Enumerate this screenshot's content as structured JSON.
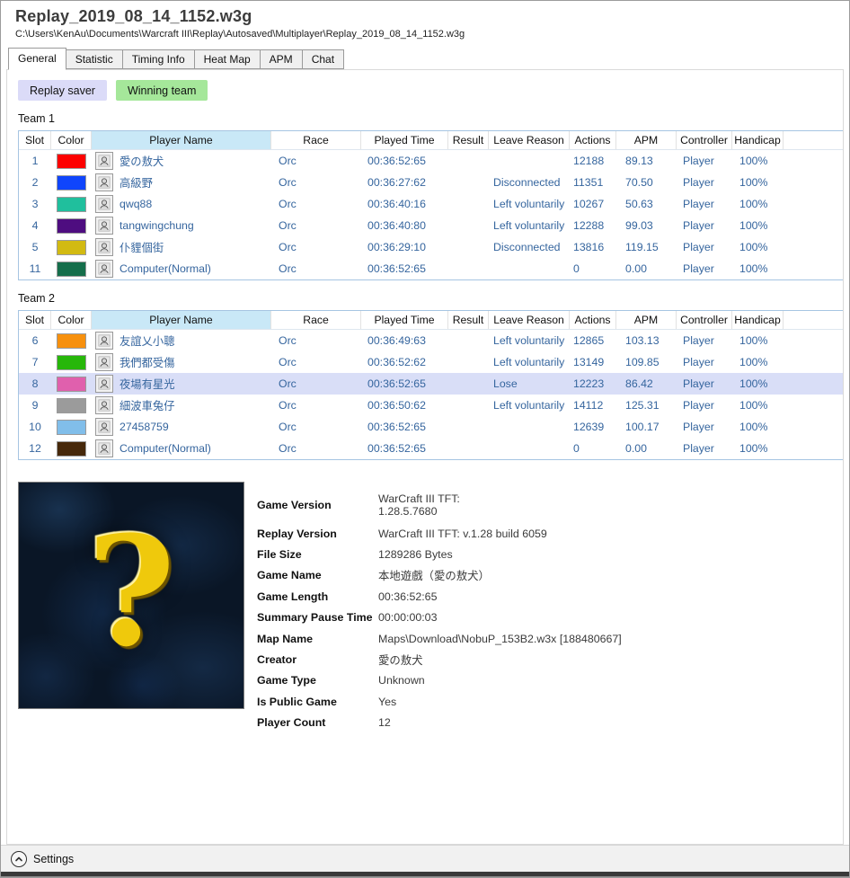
{
  "window": {
    "title": "Replay_2019_08_14_1152.w3g",
    "path": "C:\\Users\\KenAu\\Documents\\Warcraft III\\Replay\\Autosaved\\Multiplayer\\Replay_2019_08_14_1152.w3g"
  },
  "tabs": [
    {
      "label": "General",
      "active": true
    },
    {
      "label": "Statistic",
      "active": false
    },
    {
      "label": "Timing Info",
      "active": false
    },
    {
      "label": "Heat Map",
      "active": false
    },
    {
      "label": "APM",
      "active": false
    },
    {
      "label": "Chat",
      "active": false
    }
  ],
  "toolbar": {
    "replay_saver_label": "Replay saver",
    "winning_team_label": "Winning team"
  },
  "table_columns": [
    "Slot",
    "Color",
    "Player Name",
    "Race",
    "Played Time",
    "Result",
    "Leave Reason",
    "Actions",
    "APM",
    "Controller",
    "Handicap"
  ],
  "teams": [
    {
      "name": "Team 1",
      "rows": [
        {
          "slot": "1",
          "color": "#fd0100",
          "player": "愛の敖犬",
          "race": "Orc",
          "played_time": "00:36:52:65",
          "result": "",
          "leave_reason": "",
          "actions": "12188",
          "apm": "89.13",
          "controller": "Player",
          "handicap": "100%",
          "selected": false
        },
        {
          "slot": "2",
          "color": "#0f45fc",
          "player": "高級野",
          "race": "Orc",
          "played_time": "00:36:27:62",
          "result": "",
          "leave_reason": "Disconnected",
          "actions": "11351",
          "apm": "70.50",
          "controller": "Player",
          "handicap": "100%",
          "selected": false
        },
        {
          "slot": "3",
          "color": "#20bf9d",
          "player": "qwq88",
          "race": "Orc",
          "played_time": "00:36:40:16",
          "result": "",
          "leave_reason": "Left voluntarily",
          "actions": "10267",
          "apm": "50.63",
          "controller": "Player",
          "handicap": "100%",
          "selected": false
        },
        {
          "slot": "4",
          "color": "#4e0d80",
          "player": "tangwingchung",
          "race": "Orc",
          "played_time": "00:36:40:80",
          "result": "",
          "leave_reason": "Left voluntarily",
          "actions": "12288",
          "apm": "99.03",
          "controller": "Player",
          "handicap": "100%",
          "selected": false
        },
        {
          "slot": "5",
          "color": "#d2ba12",
          "player": "仆貍個街",
          "race": "Orc",
          "played_time": "00:36:29:10",
          "result": "",
          "leave_reason": "Disconnected",
          "actions": "13816",
          "apm": "119.15",
          "controller": "Player",
          "handicap": "100%",
          "selected": false
        },
        {
          "slot": "11",
          "color": "#156e4b",
          "player": "Computer(Normal)",
          "race": "Orc",
          "played_time": "00:36:52:65",
          "result": "",
          "leave_reason": "",
          "actions": "0",
          "apm": "0.00",
          "controller": "Player",
          "handicap": "100%",
          "selected": false
        }
      ]
    },
    {
      "name": "Team 2",
      "rows": [
        {
          "slot": "6",
          "color": "#f7900d",
          "player": "友誼乂小聰",
          "race": "Orc",
          "played_time": "00:36:49:63",
          "result": "",
          "leave_reason": "Left voluntarily",
          "actions": "12865",
          "apm": "103.13",
          "controller": "Player",
          "handicap": "100%",
          "selected": false
        },
        {
          "slot": "7",
          "color": "#27b70a",
          "player": "我們都受傷",
          "race": "Orc",
          "played_time": "00:36:52:62",
          "result": "",
          "leave_reason": "Left voluntarily",
          "actions": "13149",
          "apm": "109.85",
          "controller": "Player",
          "handicap": "100%",
          "selected": false
        },
        {
          "slot": "8",
          "color": "#e060ad",
          "player": "夜場有星光",
          "race": "Orc",
          "played_time": "00:36:52:65",
          "result": "",
          "leave_reason": "Lose",
          "actions": "12223",
          "apm": "86.42",
          "controller": "Player",
          "handicap": "100%",
          "selected": true
        },
        {
          "slot": "9",
          "color": "#9b9b9b",
          "player": "細波車兔仔",
          "race": "Orc",
          "played_time": "00:36:50:62",
          "result": "",
          "leave_reason": "Left voluntarily",
          "actions": "14112",
          "apm": "125.31",
          "controller": "Player",
          "handicap": "100%",
          "selected": false
        },
        {
          "slot": "10",
          "color": "#81beea",
          "player": "27458759",
          "race": "Orc",
          "played_time": "00:36:52:65",
          "result": "",
          "leave_reason": "",
          "actions": "12639",
          "apm": "100.17",
          "controller": "Player",
          "handicap": "100%",
          "selected": false
        },
        {
          "slot": "12",
          "color": "#46280a",
          "player": "Computer(Normal)",
          "race": "Orc",
          "played_time": "00:36:52:65",
          "result": "",
          "leave_reason": "",
          "actions": "0",
          "apm": "0.00",
          "controller": "Player",
          "handicap": "100%",
          "selected": false
        }
      ]
    }
  ],
  "map_preview": {
    "glyph": "?"
  },
  "info": {
    "rows": [
      {
        "label": "Game Version",
        "value": "WarCraft III TFT:\n1.28.5.7680",
        "tall": true
      },
      {
        "label": "Replay Version",
        "value": "WarCraft III TFT: v.1.28 build 6059"
      },
      {
        "label": "File Size",
        "value": "1289286 Bytes"
      },
      {
        "label": "Game Name",
        "value": "本地遊戲（愛の敖犬）"
      },
      {
        "label": "Game Length",
        "value": "00:36:52:65"
      },
      {
        "label": "Summary Pause Time",
        "value": "00:00:00:03"
      },
      {
        "label": "Map Name",
        "value": "Maps\\Download\\NobuP_153B2.w3x [188480667]"
      },
      {
        "label": "Creator",
        "value": "愛の敖犬"
      },
      {
        "label": "Game Type",
        "value": "Unknown"
      },
      {
        "label": "Is Public Game",
        "value": "Yes"
      },
      {
        "label": "Player Count",
        "value": "12"
      }
    ]
  },
  "footer": {
    "settings_label": "Settings"
  }
}
